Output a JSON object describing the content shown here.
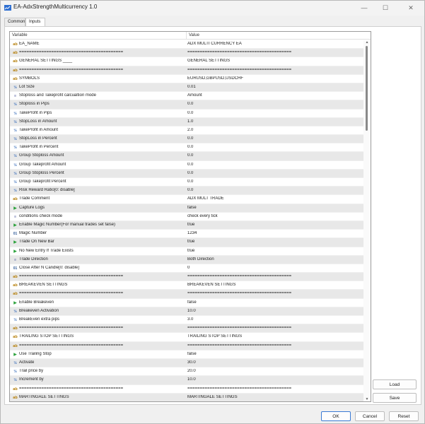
{
  "window": {
    "title": "EA-AdxStrengthMulticurrency 1.0",
    "controls": {
      "minimize": "—",
      "maximize": "☐",
      "close": "✕"
    }
  },
  "tabs": [
    {
      "label": "Common",
      "active": false
    },
    {
      "label": "Inputs",
      "active": true
    }
  ],
  "grid": {
    "headers": {
      "variable": "Variable",
      "value": "Value"
    },
    "rows": [
      {
        "icon": "ab",
        "variable": "EA_NAME",
        "value": "ADX MULTI CURRENCY EA"
      },
      {
        "icon": "ab",
        "variable": "==========================================",
        "value": "=========================================="
      },
      {
        "icon": "ab",
        "variable": "GENERAL SETTINGS ____",
        "value": "GENERAL SETTINGS"
      },
      {
        "icon": "ab",
        "variable": "==========================================",
        "value": "=========================================="
      },
      {
        "icon": "ab",
        "variable": "SYMBOLS",
        "value": "EURUSD,GBPUSD,USDCHF"
      },
      {
        "icon": "half",
        "variable": "Lot Size",
        "value": "0.01"
      },
      {
        "icon": "enum",
        "variable": "Stoploss and Takeprofit calcualtion mode",
        "value": "Amount"
      },
      {
        "icon": "half",
        "variable": "Stoploss in Pips",
        "value": "0.0"
      },
      {
        "icon": "half",
        "variable": "TakeProfit in Pips",
        "value": "0.0"
      },
      {
        "icon": "half",
        "variable": "StopLoss in Amount",
        "value": "1.0"
      },
      {
        "icon": "half",
        "variable": "TakeProfit in Amount",
        "value": "2.0"
      },
      {
        "icon": "half",
        "variable": "StopLoss in Percent",
        "value": "0.0"
      },
      {
        "icon": "half",
        "variable": "TakeProfit in Percent",
        "value": "0.0"
      },
      {
        "icon": "half",
        "variable": "Group Stoploss Amount",
        "value": "0.0"
      },
      {
        "icon": "half",
        "variable": "Group Takeprofit Amount",
        "value": "0.0"
      },
      {
        "icon": "half",
        "variable": "Group Stoploss Percent",
        "value": "0.0"
      },
      {
        "icon": "half",
        "variable": "Group Takeprofit Percent",
        "value": "0.0"
      },
      {
        "icon": "half",
        "variable": "Risk Reward Ratio[0: disable]",
        "value": "0.0"
      },
      {
        "icon": "ab",
        "variable": "Trade Comment",
        "value": "ADX MULT TRADE"
      },
      {
        "icon": "flag",
        "variable": "Capture Logs",
        "value": "false"
      },
      {
        "icon": "enum",
        "variable": "conditions check mode",
        "value": "check every tick"
      },
      {
        "icon": "flag",
        "variable": "Enable Magic Number(For manual trades set false)",
        "value": "true"
      },
      {
        "icon": "01",
        "variable": "Magic Number",
        "value": "1234"
      },
      {
        "icon": "flag",
        "variable": "Trade On New Bar",
        "value": "true"
      },
      {
        "icon": "flag",
        "variable": "No New Entry If Trade Exists",
        "value": "true"
      },
      {
        "icon": "enum",
        "variable": "Trade Direction",
        "value": "Both Direction"
      },
      {
        "icon": "01",
        "variable": "Close After N Candle[0: disable]",
        "value": "0"
      },
      {
        "icon": "ab",
        "variable": "==========================================",
        "value": "=========================================="
      },
      {
        "icon": "ab",
        "variable": "BREAKEVEN SETTINGS",
        "value": "BREAKEVEN SETTINGS"
      },
      {
        "icon": "ab",
        "variable": "==========================================",
        "value": "=========================================="
      },
      {
        "icon": "flag",
        "variable": "Enable Breakeven",
        "value": "false"
      },
      {
        "icon": "half",
        "variable": "Breakeven Activation",
        "value": "10.0"
      },
      {
        "icon": "half",
        "variable": "BreakEven extra pips",
        "value": "3.0"
      },
      {
        "icon": "ab",
        "variable": "==========================================",
        "value": "=========================================="
      },
      {
        "icon": "ab",
        "variable": "TRAILING STOP SETTINGS",
        "value": "TRAILING STOP SETTINGS"
      },
      {
        "icon": "ab",
        "variable": "==========================================",
        "value": "=========================================="
      },
      {
        "icon": "flag",
        "variable": "Use Trailing Stop",
        "value": "false"
      },
      {
        "icon": "half",
        "variable": "Activate",
        "value": "30.0"
      },
      {
        "icon": "half",
        "variable": "Trail price by",
        "value": "20.0"
      },
      {
        "icon": "half",
        "variable": "Increment by",
        "value": "10.0"
      },
      {
        "icon": "ab",
        "variable": "==========================================",
        "value": "=========================================="
      },
      {
        "icon": "ab",
        "variable": "MARTINGALE SETTINGS",
        "value": "MARTINGALE SETTINGS"
      }
    ]
  },
  "side_buttons": {
    "load": "Load",
    "save": "Save"
  },
  "footer": {
    "ok": "OK",
    "cancel": "Cancel",
    "reset": "Reset"
  },
  "icons": {
    "ab": "ab",
    "half": "½",
    "01": "01",
    "flag": "▶",
    "enum": "≡"
  },
  "colors": {
    "accent": "#3b7bd4",
    "alt_row": "#e8e8e8"
  }
}
